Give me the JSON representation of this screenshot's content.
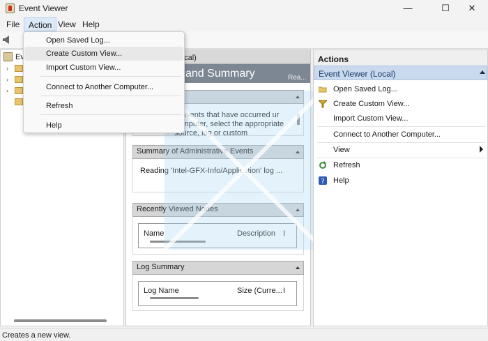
{
  "window": {
    "title": "Event Viewer",
    "minimize_glyph": "—",
    "maximize_glyph": "☐",
    "close_glyph": "✕"
  },
  "menubar": [
    "File",
    "Action",
    "View",
    "Help"
  ],
  "action_menu": {
    "items": [
      "Open Saved Log...",
      "Create Custom View...",
      "Import Custom View...",
      "Connect to Another Computer...",
      "Refresh",
      "Help"
    ],
    "highlighted": "Create Custom View..."
  },
  "tree": {
    "root_label": "Ev"
  },
  "center": {
    "header": "ocal)",
    "banner_title": "and Summary",
    "banner_right": "Rea...",
    "overview_text": "w events that have occurred ur computer, select the appropriate source, log or custom",
    "sections": [
      {
        "title": "Summary of Administrative Events",
        "body": "Reading 'Intel-GFX-Info/Application' log ..."
      },
      {
        "title": "Recently Viewed Nodes",
        "columns": [
          "Name",
          "Description",
          "I"
        ]
      },
      {
        "title": "Log Summary",
        "columns": [
          "Log Name",
          "Size (Curre...",
          "I"
        ]
      }
    ]
  },
  "actions": {
    "title": "Actions",
    "section": "Event Viewer (Local)",
    "items": [
      {
        "label": "Open Saved Log...",
        "icon": "folder-open-icon"
      },
      {
        "label": "Create Custom View...",
        "icon": "filter-icon"
      },
      {
        "label": "Import Custom View...",
        "icon": ""
      },
      {
        "label": "Connect to Another Computer...",
        "icon": ""
      },
      {
        "label": "View",
        "icon": "chevron-right-icon"
      },
      {
        "label": "Refresh",
        "icon": "refresh-icon"
      },
      {
        "label": "Help",
        "icon": "help-icon"
      }
    ]
  },
  "status": "Creates a new view."
}
